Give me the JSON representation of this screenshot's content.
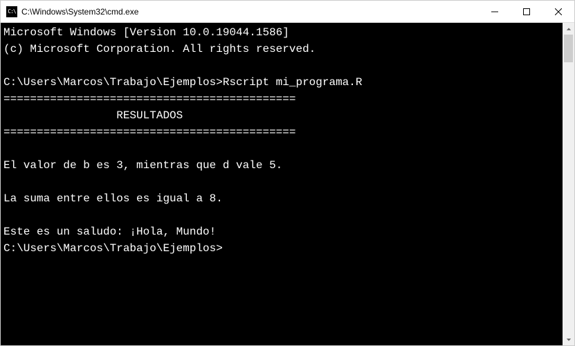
{
  "titlebar": {
    "icon_text": "C:\\",
    "title": "C:\\Windows\\System32\\cmd.exe"
  },
  "console": {
    "lines": [
      "Microsoft Windows [Version 10.0.19044.1586]",
      "(c) Microsoft Corporation. All rights reserved.",
      "",
      "C:\\Users\\Marcos\\Trabajo\\Ejemplos>Rscript mi_programa.R",
      "============================================",
      "                 RESULTADOS",
      "============================================",
      "",
      "El valor de b es 3, mientras que d vale 5.",
      "",
      "La suma entre ellos es igual a 8.",
      "",
      "Este es un saludo: ¡Hola, Mundo!",
      "C:\\Users\\Marcos\\Trabajo\\Ejemplos>"
    ]
  }
}
